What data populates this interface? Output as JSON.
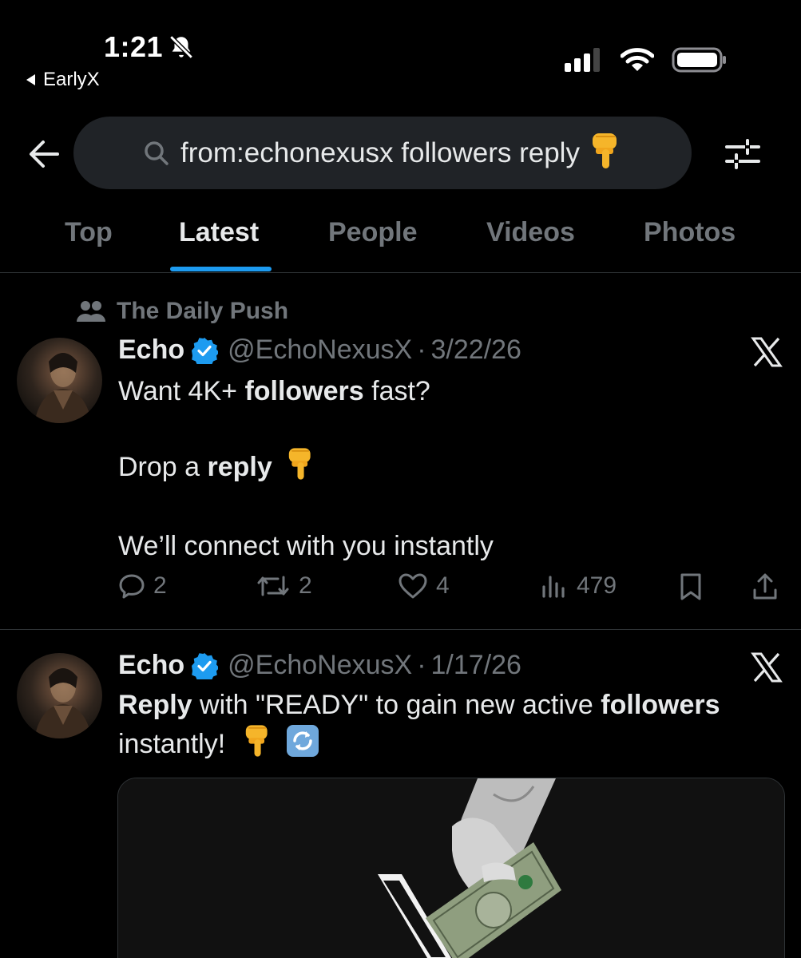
{
  "status_bar": {
    "time": "1:21",
    "back_app": "EarlyX"
  },
  "search": {
    "query": "from:echonexusx followers reply",
    "emoji": "👇"
  },
  "tabs": [
    {
      "label": "Top",
      "active": false
    },
    {
      "label": "Latest",
      "active": true
    },
    {
      "label": "People",
      "active": false
    },
    {
      "label": "Videos",
      "active": false
    },
    {
      "label": "Photos",
      "active": false
    }
  ],
  "posts": [
    {
      "social_context": "The Daily Push",
      "display_name": "Echo",
      "handle": "@EchoNexusX",
      "separator": "·",
      "date": "3/22/26",
      "body": {
        "line1_pre": "Want 4K+ ",
        "line1_bold": "followers",
        "line1_post": " fast?",
        "line2_pre": "Drop a ",
        "line2_bold": "reply",
        "line3": "We’ll connect with you instantly"
      },
      "stats": {
        "replies": "2",
        "reposts": "2",
        "likes": "4",
        "views": "479"
      }
    },
    {
      "display_name": "Echo",
      "handle": "@EchoNexusX",
      "separator": "·",
      "date": "1/17/26",
      "body": {
        "bold1": "Reply",
        "mid": " with \"READY\" to gain new active ",
        "bold2": "followers",
        "end": "instantly!"
      }
    }
  ],
  "colors": {
    "background": "#000000",
    "accent": "#1d9bf0",
    "muted_text": "#71767b",
    "primary_text": "#e7e9ea",
    "search_bg": "#202327",
    "divider": "#2f3336"
  },
  "icons": {
    "search": "search-icon",
    "back": "back-arrow-icon",
    "filter": "filter-sliders-icon",
    "verified": "verified-badge-icon",
    "x_logo": "x-logo-icon",
    "reply": "reply-icon",
    "repost": "repost-icon",
    "like": "heart-icon",
    "views": "views-icon",
    "bookmark": "bookmark-icon",
    "share": "share-icon"
  }
}
